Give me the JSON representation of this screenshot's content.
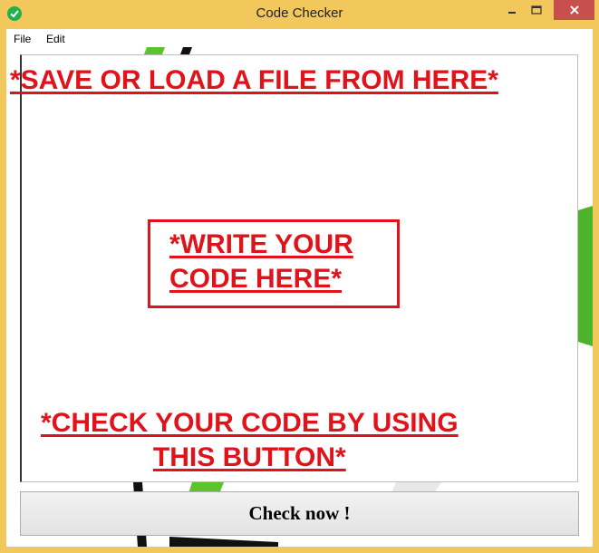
{
  "window": {
    "title": "Code Checker",
    "accent_color": "#F2C75C",
    "close_color": "#C7504F"
  },
  "menu": {
    "items": [
      {
        "label": "File"
      },
      {
        "label": "Edit"
      }
    ]
  },
  "editor": {
    "value": ""
  },
  "annotations": {
    "save_load": "*SAVE OR LOAD A FILE FROM HERE*",
    "write_line1": "*WRITE YOUR",
    "write_line2": "CODE HERE*",
    "check_line1": "*CHECK YOUR CODE BY USING",
    "check_line2": "THIS BUTTON*",
    "color": "#E0131B"
  },
  "button": {
    "label": "Check now !"
  }
}
